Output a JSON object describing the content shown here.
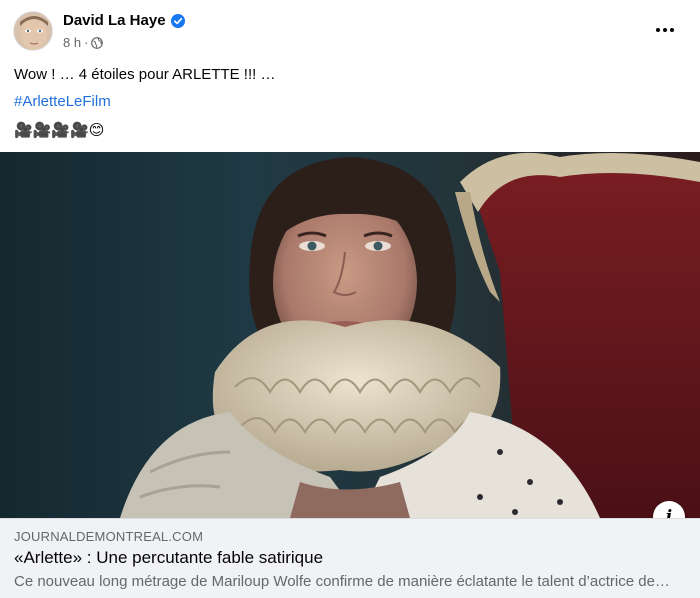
{
  "post": {
    "author": "David La Haye",
    "verified_icon": "verified-badge-icon",
    "timestamp": "8 h",
    "separator": "·",
    "audience_icon": "globe-icon",
    "more_icon": "more-options-icon",
    "message_line1": "Wow ! … 4 étoiles pour ARLETTE !!! …",
    "hashtag": "#ArletteLeFilm",
    "emojis": "🎥🎥🎥🎥😊"
  },
  "link_preview": {
    "domain": "JOURNALDEMONTREAL.COM",
    "title": "«Arlette» : Une percutante fable satirique",
    "description": "Ce nouveau long métrage de Mariloup Wolfe confirme de manière éclatante le talent d’actrice de Maripier Morin",
    "info_icon": "info-icon"
  },
  "colors": {
    "link_blue": "#216fdb",
    "verified_blue": "#1877f2",
    "secondary_text": "#65676b",
    "preview_bg": "#f0f2f5"
  }
}
